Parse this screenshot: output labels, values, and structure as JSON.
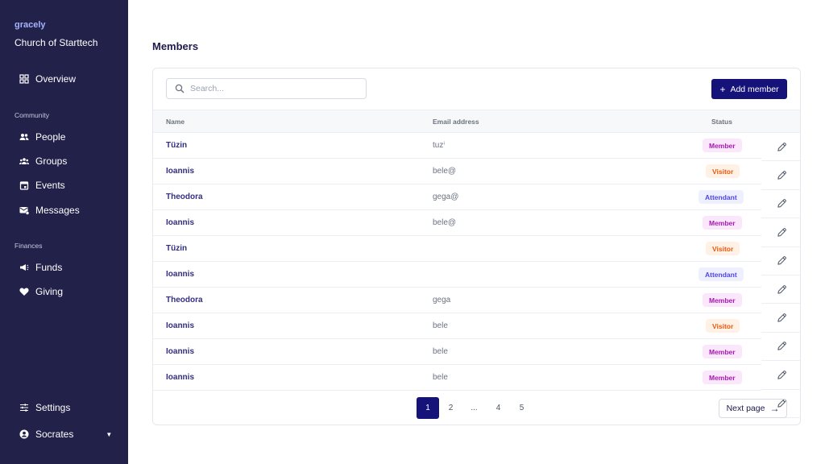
{
  "sidebar": {
    "brand": "gracely",
    "org_name": "Church of Starttech",
    "overview": "Overview",
    "community_label": "Community",
    "community_items": [
      "People",
      "Groups",
      "Events",
      "Messages"
    ],
    "finances_label": "Finances",
    "finance_items": [
      "Funds",
      "Giving"
    ],
    "settings": "Settings",
    "user": "Socrates"
  },
  "main": {
    "title": "Members",
    "search_placeholder": "Search...",
    "add_button": "Add member",
    "columns": {
      "name": "Name",
      "email": "Email address",
      "status": "Status"
    },
    "rows": [
      {
        "name": "Tüzin",
        "email": "tuzⁱ",
        "status": "Member"
      },
      {
        "name": "Ioannis",
        "email": "bele@",
        "status": "Visitor"
      },
      {
        "name": "Theodora",
        "email": "gega@",
        "status": "Attendant"
      },
      {
        "name": "Ioannis",
        "email": "bele@",
        "status": "Member"
      },
      {
        "name": "Tüzin",
        "email": "",
        "status": "Visitor"
      },
      {
        "name": "Ioannis",
        "email": "",
        "status": "Attendant"
      },
      {
        "name": "Theodora",
        "email": "gega",
        "status": "Member"
      },
      {
        "name": "Ioannis",
        "email": "bele",
        "status": "Visitor"
      },
      {
        "name": "Ioannis",
        "email": "bele",
        "status": "Member"
      },
      {
        "name": "Ioannis",
        "email": "bele",
        "status": "Member"
      }
    ],
    "pagination": {
      "pages": [
        "1",
        "2",
        "...",
        "4",
        "5"
      ],
      "current": "1",
      "next_label": "Next page"
    }
  },
  "colors": {
    "sidebar_bg": "#22214a",
    "accent": "#15137a",
    "member": "#a21caf",
    "visitor": "#ea580c",
    "attendant": "#4f46e5"
  }
}
